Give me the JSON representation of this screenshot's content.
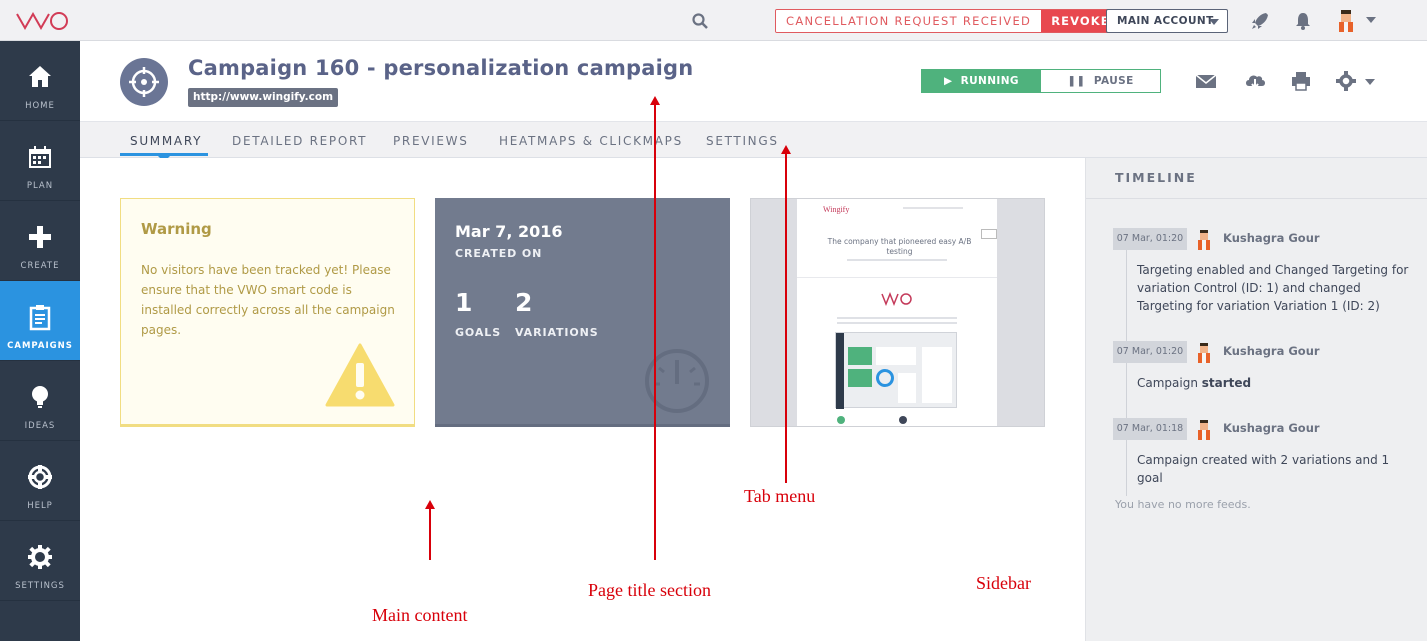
{
  "topbar": {
    "logo_text": "VWO",
    "cancellation_text": "CANCELLATION REQUEST RECEIVED",
    "revoke_label": "REVOKE",
    "account_label": "MAIN ACCOUNT",
    "icons": [
      "search-icon",
      "rocket-icon",
      "bell-icon",
      "avatar",
      "chevron-down-icon"
    ]
  },
  "nav": {
    "items": [
      {
        "label": "HOME",
        "icon": "home-icon",
        "active": false
      },
      {
        "label": "PLAN",
        "icon": "calendar-icon",
        "active": false
      },
      {
        "label": "CREATE",
        "icon": "plus-icon",
        "active": false
      },
      {
        "label": "CAMPAIGNS",
        "icon": "clipboard-icon",
        "active": true
      },
      {
        "label": "IDEAS",
        "icon": "bulb-icon",
        "active": false
      },
      {
        "label": "HELP",
        "icon": "lifebuoy-icon",
        "active": false
      },
      {
        "label": "SETTINGS",
        "icon": "gear-icon",
        "active": false
      }
    ]
  },
  "header": {
    "title": "Campaign 160 - personalization campaign",
    "url": "http://www.wingify.com",
    "running_label": "RUNNING",
    "pause_label": "PAUSE",
    "icons": [
      "mail-icon",
      "cloud-download-icon",
      "print-icon",
      "gear-icon"
    ]
  },
  "tabs": [
    {
      "label": "SUMMARY",
      "active": true
    },
    {
      "label": "DETAILED REPORT",
      "active": false
    },
    {
      "label": "PREVIEWS",
      "active": false
    },
    {
      "label": "HEATMAPS & CLICKMAPS",
      "active": false
    },
    {
      "label": "SETTINGS",
      "active": false
    }
  ],
  "warning": {
    "title": "Warning",
    "text": "No visitors have been tracked yet! Please ensure that the VWO smart code is installed correctly across all the campaign pages."
  },
  "stats": {
    "date": "Mar 7, 2016",
    "created_label": "CREATED ON",
    "goals_value": "1",
    "goals_label": "GOALS",
    "variations_value": "2",
    "variations_label": "VARIATIONS"
  },
  "preview": {
    "brand": "Wingify",
    "headline": "The company that pioneered easy A/B testing"
  },
  "timeline": {
    "heading": "TIMELINE",
    "entries": [
      {
        "time": "07 Mar, 01:20",
        "user": "Kushagra Gour",
        "text": "Targeting enabled and Changed Targeting for variation Control (ID: 1) and changed Targeting for variation Variation 1 (ID: 2)",
        "emphasis": ""
      },
      {
        "time": "07 Mar, 01:20",
        "user": "Kushagra Gour",
        "text": "Campaign ",
        "emphasis": "started"
      },
      {
        "time": "07 Mar, 01:18",
        "user": "Kushagra Gour",
        "text": "Campaign created with 2 variations and 1 goal",
        "emphasis": ""
      }
    ],
    "no_more": "You have no more feeds."
  },
  "annotations": {
    "tab_menu": "Tab menu",
    "page_title_section": "Page title section",
    "main_content": "Main content",
    "sidebar": "Sidebar"
  },
  "colors": {
    "nav_bg": "#2e3a4a",
    "nav_active": "#2b93e0",
    "running_green": "#4fb27d",
    "revoke_red": "#e8484f",
    "warning_text": "#b09a46",
    "stats_card": "#727b8e",
    "annotation_red": "#d8000a"
  }
}
